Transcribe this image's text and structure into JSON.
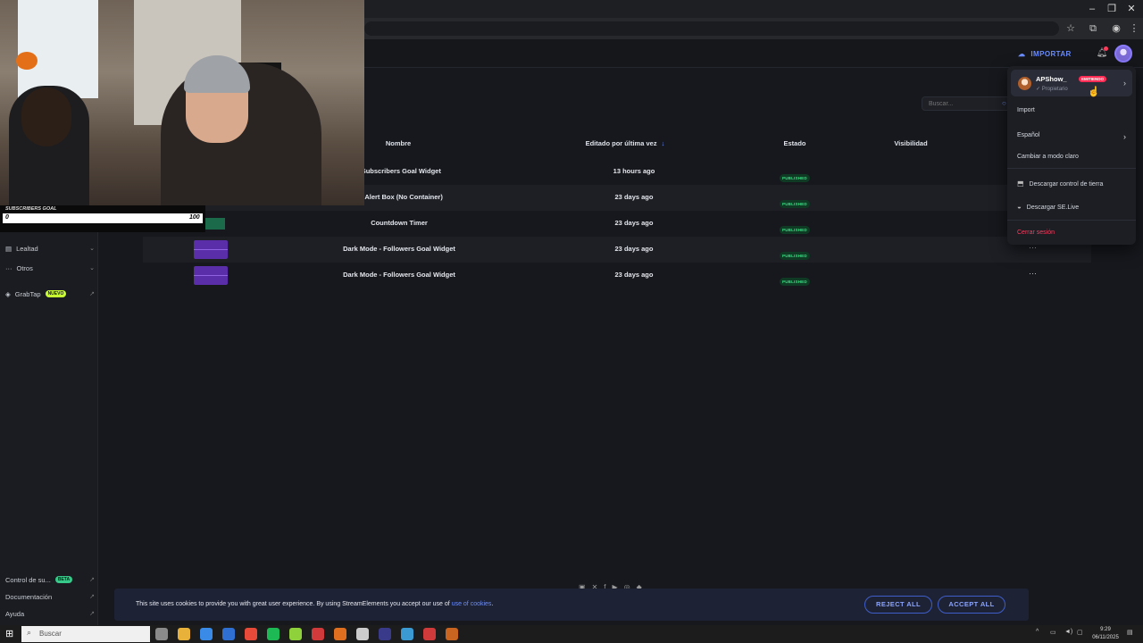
{
  "browser": {
    "window_controls": [
      "–",
      "❐",
      "✕"
    ],
    "toolbar_icons": [
      "star-icon",
      "puzzle-icon",
      "profile-icon",
      "kebab-icon"
    ]
  },
  "header": {
    "import_label": "IMPORTAR",
    "import_icon": "cloud-upload-icon",
    "notification_icon": "bell-icon"
  },
  "search": {
    "placeholder": "Buscar..."
  },
  "table": {
    "columns": [
      "Nombre",
      "Editado por última vez",
      "Estado",
      "Visibilidad"
    ],
    "rows": [
      {
        "name": "- Subscribers Goal Widget",
        "edited": "13 hours ago",
        "status": "PUBLISHED"
      },
      {
        "name": "ay Alert Box (No Container)",
        "edited": "23 days ago",
        "status": "PUBLISHED"
      },
      {
        "name": "Countdown Timer",
        "edited": "23 days ago",
        "status": "PUBLISHED"
      },
      {
        "name": "Dark Mode - Followers Goal Widget",
        "edited": "23 days ago",
        "status": "PUBLISHED"
      },
      {
        "name": "Dark Mode - Followers Goal Widget",
        "edited": "23 days ago",
        "status": "PUBLISHED"
      }
    ]
  },
  "sidebar": {
    "items": [
      {
        "label": "Lealtad",
        "icon": "loyalty-icon"
      },
      {
        "label": "Otros",
        "icon": "more-icon"
      },
      {
        "label": "GrabTap",
        "badge": "NUEVO",
        "icon": "grabtap-icon"
      }
    ],
    "bottom_items": [
      {
        "label": "Control de su...",
        "badge": "BETA"
      },
      {
        "label": "Documentación"
      },
      {
        "label": "Ayuda"
      }
    ]
  },
  "menu": {
    "username": "APShow_",
    "role": "Propietario",
    "live_badge": "EMITIENDO",
    "import": "Import",
    "language": "Español",
    "theme": "Cambiar a modo claro",
    "download_ground": "Descargar control de tierra",
    "download_live": "Descargar SE.Live",
    "logout": "Cerrar sesión"
  },
  "overlay": {
    "goal_title": "SUBSCRIBERS GOAL",
    "goal_min": "0",
    "goal_max": "100",
    "goal_progress": 0
  },
  "cookie": {
    "text": "This site uses cookies to provide you with great user experience. By using StreamElements you accept our use of ",
    "link": "use of cookies",
    "end": ".",
    "reject": "REJECT ALL",
    "accept": "ACCEPT ALL"
  },
  "taskbar": {
    "search_placeholder": "Buscar",
    "time": "9:29",
    "date": "06/11/2025",
    "app_colors": [
      "#8a8a8a",
      "#e8b13a",
      "#3a8be8",
      "#2f6fd1",
      "#e84a3a",
      "#1db954",
      "#8fd13a",
      "#d13a3a",
      "#e0701f",
      "#cccccc",
      "#3a3a8a",
      "#3a9ad1",
      "#d13a3a",
      "#c8641f"
    ]
  },
  "colors": {
    "accent": "#6a8cff",
    "published": "#3ddc84",
    "live": "#ff2d55",
    "logout": "#ff3b5c",
    "new_badge": "#c8ff33"
  }
}
